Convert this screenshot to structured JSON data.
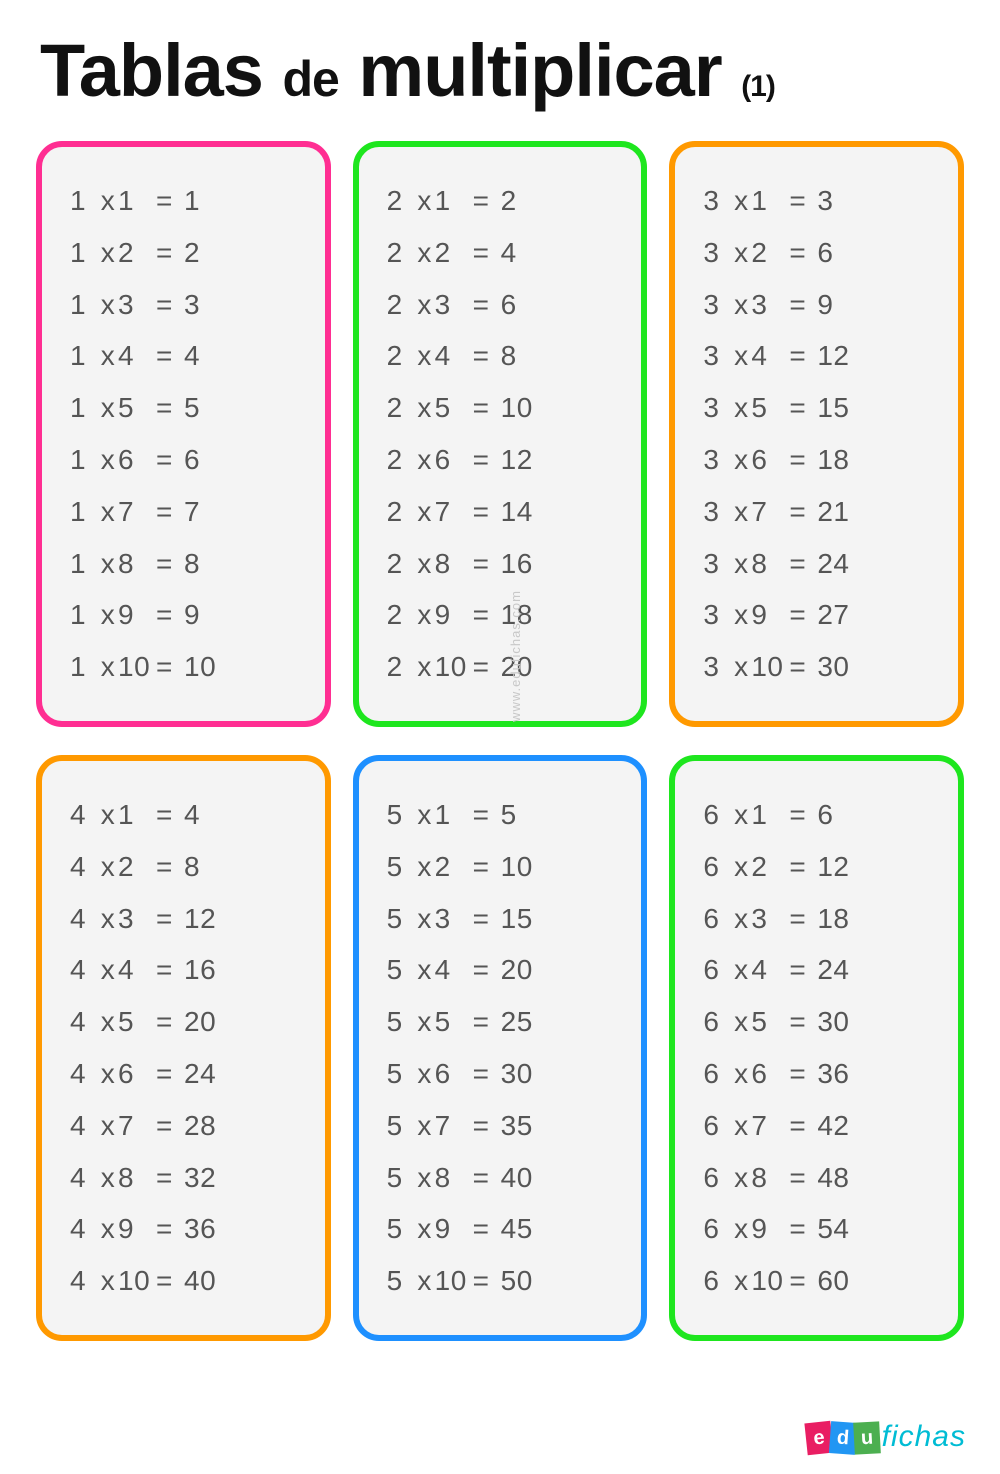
{
  "title": {
    "main1": "Tablas",
    "de": "de",
    "main2": "multiplicar",
    "sub": "(1)"
  },
  "watermark": "www.edufichas.com",
  "logo": {
    "edu": "edu",
    "fichas": "fichas"
  },
  "colors": {
    "pink": "#ff2e92",
    "green": "#1ee61e",
    "orange": "#ff9900",
    "blue": "#1e90ff"
  },
  "chart_data": {
    "type": "table",
    "title": "Tablas de multiplicar (1)",
    "tables": [
      {
        "n": 1,
        "border": "pink",
        "rows": [
          [
            1,
            1,
            1
          ],
          [
            1,
            2,
            2
          ],
          [
            1,
            3,
            3
          ],
          [
            1,
            4,
            4
          ],
          [
            1,
            5,
            5
          ],
          [
            1,
            6,
            6
          ],
          [
            1,
            7,
            7
          ],
          [
            1,
            8,
            8
          ],
          [
            1,
            9,
            9
          ],
          [
            1,
            10,
            10
          ]
        ]
      },
      {
        "n": 2,
        "border": "green",
        "rows": [
          [
            2,
            1,
            2
          ],
          [
            2,
            2,
            4
          ],
          [
            2,
            3,
            6
          ],
          [
            2,
            4,
            8
          ],
          [
            2,
            5,
            10
          ],
          [
            2,
            6,
            12
          ],
          [
            2,
            7,
            14
          ],
          [
            2,
            8,
            16
          ],
          [
            2,
            9,
            18
          ],
          [
            2,
            10,
            20
          ]
        ]
      },
      {
        "n": 3,
        "border": "orange",
        "rows": [
          [
            3,
            1,
            3
          ],
          [
            3,
            2,
            6
          ],
          [
            3,
            3,
            9
          ],
          [
            3,
            4,
            12
          ],
          [
            3,
            5,
            15
          ],
          [
            3,
            6,
            18
          ],
          [
            3,
            7,
            21
          ],
          [
            3,
            8,
            24
          ],
          [
            3,
            9,
            27
          ],
          [
            3,
            10,
            30
          ]
        ]
      },
      {
        "n": 4,
        "border": "orange",
        "rows": [
          [
            4,
            1,
            4
          ],
          [
            4,
            2,
            8
          ],
          [
            4,
            3,
            12
          ],
          [
            4,
            4,
            16
          ],
          [
            4,
            5,
            20
          ],
          [
            4,
            6,
            24
          ],
          [
            4,
            7,
            28
          ],
          [
            4,
            8,
            32
          ],
          [
            4,
            9,
            36
          ],
          [
            4,
            10,
            40
          ]
        ]
      },
      {
        "n": 5,
        "border": "blue",
        "rows": [
          [
            5,
            1,
            5
          ],
          [
            5,
            2,
            10
          ],
          [
            5,
            3,
            15
          ],
          [
            5,
            4,
            20
          ],
          [
            5,
            5,
            25
          ],
          [
            5,
            6,
            30
          ],
          [
            5,
            7,
            35
          ],
          [
            5,
            8,
            40
          ],
          [
            5,
            9,
            45
          ],
          [
            5,
            10,
            50
          ]
        ]
      },
      {
        "n": 6,
        "border": "green",
        "rows": [
          [
            6,
            1,
            6
          ],
          [
            6,
            2,
            12
          ],
          [
            6,
            3,
            18
          ],
          [
            6,
            4,
            24
          ],
          [
            6,
            5,
            30
          ],
          [
            6,
            6,
            36
          ],
          [
            6,
            7,
            42
          ],
          [
            6,
            8,
            48
          ],
          [
            6,
            9,
            54
          ],
          [
            6,
            10,
            60
          ]
        ]
      }
    ]
  }
}
